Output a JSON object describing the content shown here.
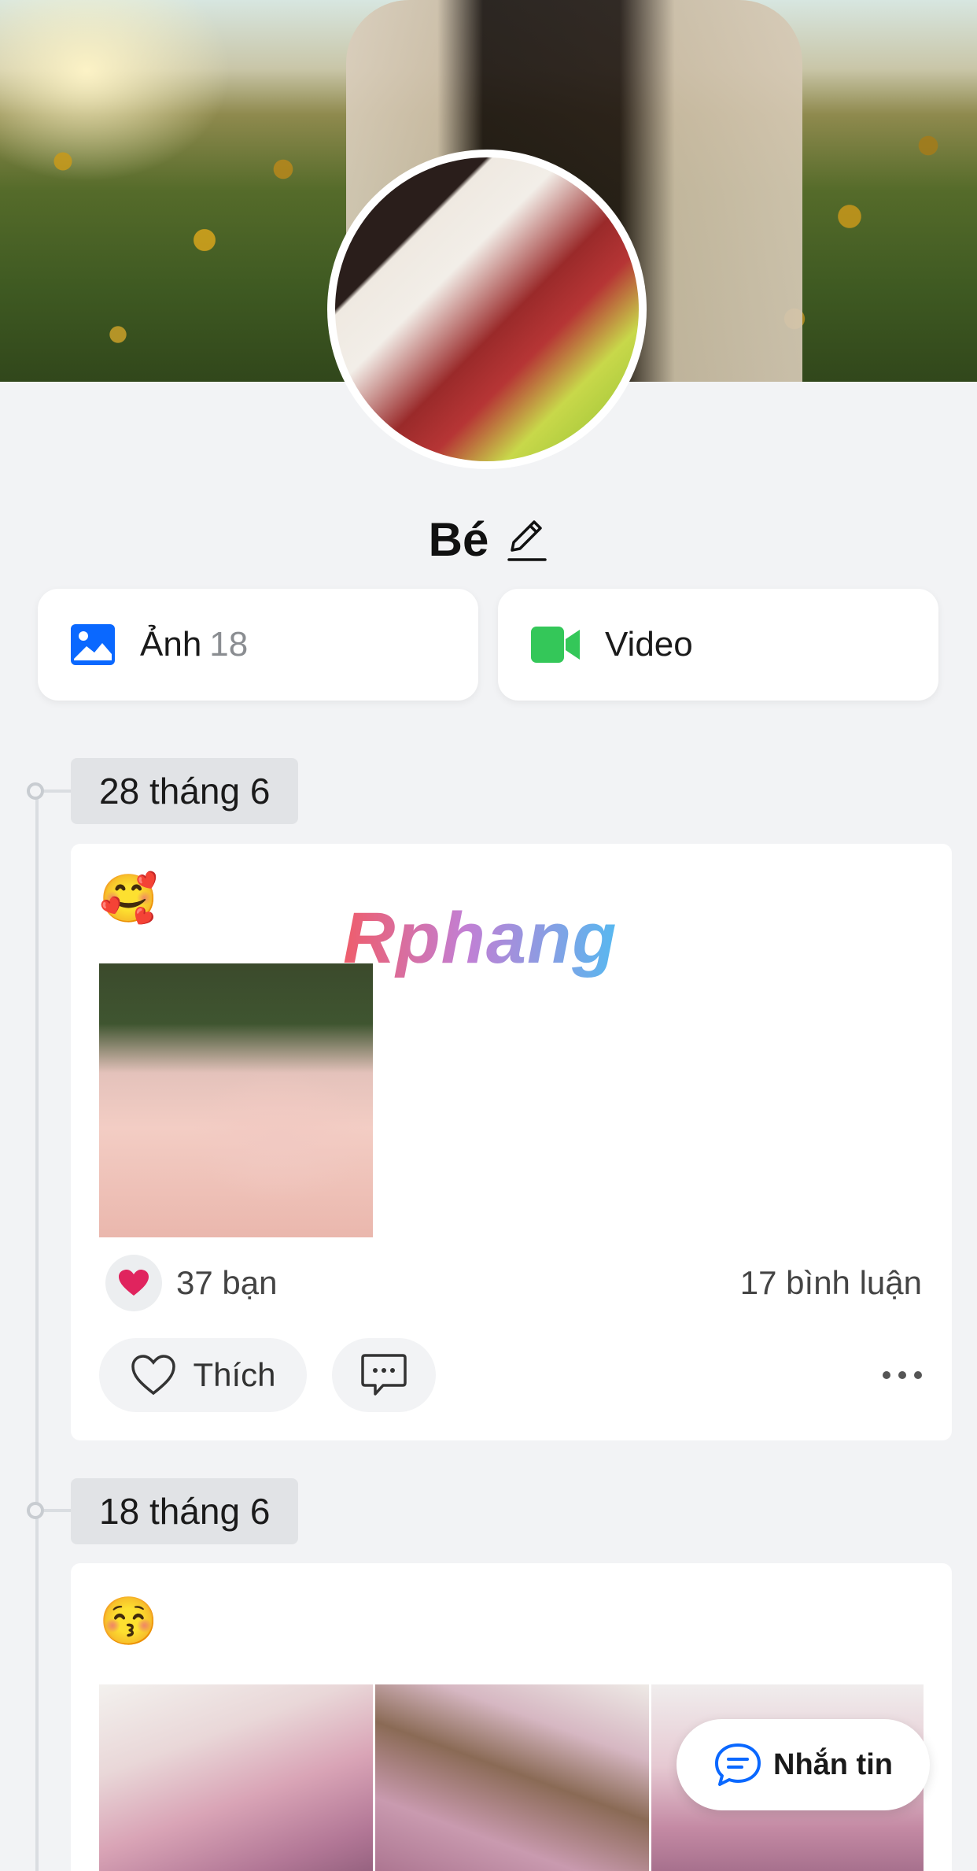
{
  "profile": {
    "name": "Bé"
  },
  "media": {
    "photos_label": "Ảnh",
    "photos_count": "18",
    "video_label": "Video"
  },
  "watermark": "Rphang",
  "posts": [
    {
      "date": "28 tháng 6",
      "emoji": "🥰",
      "reaction_count": "37 bạn",
      "comment_count": "17 bình luận",
      "like_label": "Thích"
    },
    {
      "date": "18 tháng 6",
      "emoji": "😚"
    }
  ],
  "message_button": {
    "label": "Nhắn tin"
  },
  "colors": {
    "accent_blue": "#0a68ff",
    "video_green": "#34c759",
    "heart_red": "#e0245e"
  },
  "icons": [
    "edit-icon",
    "photo-icon",
    "video-camera-icon",
    "heart-icon",
    "comment-icon",
    "more-icon",
    "chat-bubble-icon"
  ]
}
